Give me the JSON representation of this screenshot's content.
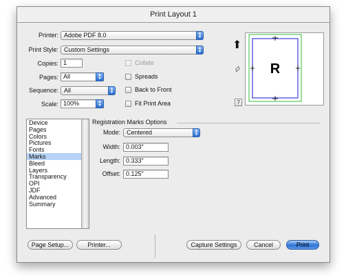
{
  "window": {
    "title": "Print Layout 1"
  },
  "printer": {
    "label": "Printer:",
    "value": "Adobe PDF 8.0"
  },
  "print_style": {
    "label": "Print Style:",
    "value": "Custom Settings"
  },
  "copies": {
    "label": "Copies:",
    "value": "1"
  },
  "pages": {
    "label": "Pages:",
    "value": "All"
  },
  "sequence": {
    "label": "Sequence:",
    "value": "All"
  },
  "scale": {
    "label": "Scale:",
    "value": "100%"
  },
  "checkboxes": {
    "collate": "Collate",
    "spreads": "Spreads",
    "back_to_front": "Back to Front",
    "fit_print_area": "Fit Print Area"
  },
  "preview": {
    "letter": "R",
    "help": "?",
    "up_icon": "thick-up-arrow-icon",
    "rotate_icon": "rotate-page-icon"
  },
  "sidebar": {
    "items": [
      "Device",
      "Pages",
      "Colors",
      "Pictures",
      "Fonts",
      "Marks",
      "Bleed",
      "Layers",
      "Transparency",
      "OPI",
      "JDF",
      "Advanced",
      "Summary"
    ],
    "selected_index": 5
  },
  "registration": {
    "title": "Registration Marks Options",
    "mode": {
      "label": "Mode:",
      "value": "Centered"
    },
    "width": {
      "label": "Width:",
      "value": "0.003\""
    },
    "length": {
      "label": "Length:",
      "value": "0.333\""
    },
    "offset": {
      "label": "Offset:",
      "value": "0.125\""
    }
  },
  "buttons": {
    "page_setup": "Page Setup...",
    "printer": "Printer...",
    "capture_settings": "Capture Settings",
    "cancel": "Cancel",
    "print": "Print"
  },
  "colors": {
    "accent": "#2e6fd1",
    "crop_green": "#2fbf3a",
    "page_outline": "#3b3bd8"
  }
}
